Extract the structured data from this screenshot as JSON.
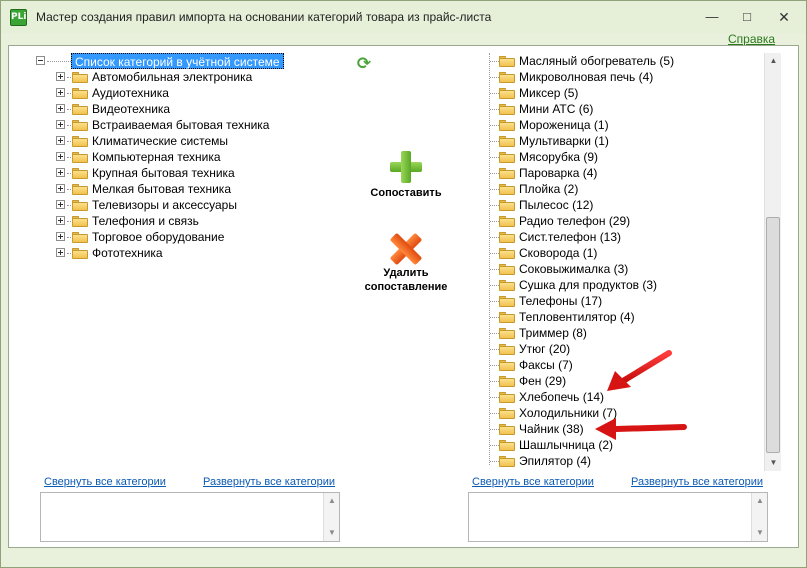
{
  "window": {
    "title": "Мастер создания правил импорта на основании категорий товара из прайс-листа",
    "app_icon_text": "PLi",
    "help_link": "Справка",
    "controls": {
      "minimize": "—",
      "maximize": "□",
      "close": "✕"
    }
  },
  "left_tree": {
    "root_label": "Список категорий в учётной системе",
    "items": [
      "Автомобильная электроника",
      "Аудиотехника",
      "Видеотехника",
      "Встраиваемая бытовая техника",
      "Климатические системы",
      "Компьютерная техника",
      "Крупная бытовая техника",
      "Мелкая бытовая техника",
      "Телевизоры и аксессуары",
      "Телефония и связь",
      "Торговое оборудование",
      "Фототехника"
    ],
    "collapse_all": "Свернуть все категории",
    "expand_all": "Развернуть все категории"
  },
  "actions": {
    "refresh_icon": "refresh-icon",
    "match_label": "Сопоставить",
    "delete_label_line1": "Удалить",
    "delete_label_line2": "сопоставление"
  },
  "right_tree": {
    "items": [
      "Масляный обогреватель (5)",
      "Микроволновая печь (4)",
      "Миксер (5)",
      "Мини АТС (6)",
      "Мороженица (1)",
      "Мультиварки (1)",
      "Мясорубка (9)",
      "Пароварка (4)",
      "Плойка (2)",
      "Пылесос (12)",
      "Радио телефон (29)",
      "Сист.телефон (13)",
      "Сковорода (1)",
      "Соковыжималка (3)",
      "Сушка для продуктов (3)",
      "Телефоны (17)",
      "Тепловентилятор (4)",
      "Триммер (8)",
      "Утюг (20)",
      "Факсы (7)",
      "Фен (29)",
      "Хлебопечь (14)",
      "Холодильники (7)",
      "Чайник (38)",
      "Шашлычница (2)",
      "Эпилятор (4)"
    ],
    "collapse_all": "Свернуть все категории",
    "expand_all": "Развернуть все категории"
  },
  "colors": {
    "window_bg": "#e9f1dd",
    "selection": "#3399ff",
    "help_link": "#2a7a1e",
    "link": "#0b5ab3",
    "arrow": "#e31414"
  }
}
